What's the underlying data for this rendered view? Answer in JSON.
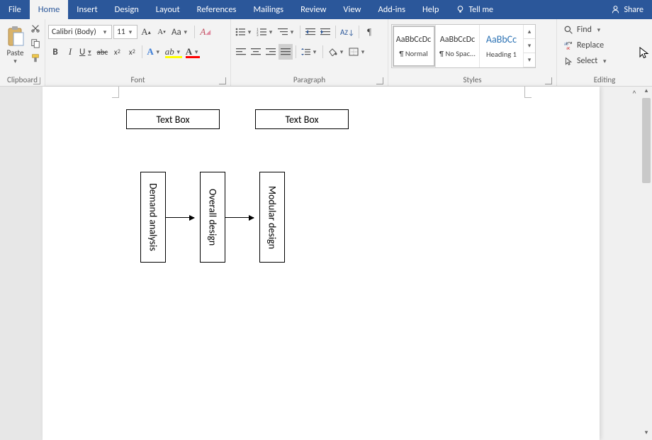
{
  "tabs": {
    "file": "File",
    "home": "Home",
    "insert": "Insert",
    "design": "Design",
    "layout": "Layout",
    "references": "References",
    "mailings": "Mailings",
    "review": "Review",
    "view": "View",
    "addins": "Add-ins",
    "help": "Help"
  },
  "tellme": "Tell me",
  "share": "Share",
  "clipboard": {
    "paste": "Paste",
    "label": "Clipboard"
  },
  "font": {
    "name": "Calibri (Body)",
    "size": "11",
    "label": "Font",
    "bold": "B",
    "italic": "I",
    "underline": "U",
    "strike": "abc",
    "sub": "x",
    "sup": "x",
    "clear": "A"
  },
  "paragraph": {
    "label": "Paragraph"
  },
  "styles": {
    "label": "Styles",
    "items": [
      {
        "preview": "AaBbCcDc",
        "name": "¶ Normal"
      },
      {
        "preview": "AaBbCcDc",
        "name": "¶ No Spac..."
      },
      {
        "preview": "AaBbCc",
        "name": "Heading 1"
      }
    ]
  },
  "editing": {
    "label": "Editing",
    "find": "Find",
    "replace": "Replace",
    "select": "Select"
  },
  "doc": {
    "textbox1": "Text Box",
    "textbox2": "Text Box",
    "flow": [
      "Demand analysis",
      "Overall design",
      "Modular design"
    ]
  }
}
